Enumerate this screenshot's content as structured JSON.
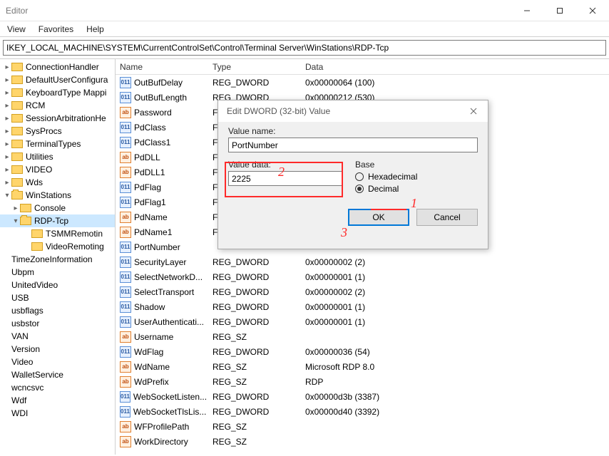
{
  "window": {
    "title": "Editor"
  },
  "menu": {
    "items": [
      "View",
      "Favorites",
      "Help"
    ]
  },
  "address": "IKEY_LOCAL_MACHINE\\SYSTEM\\CurrentControlSet\\Control\\Terminal Server\\WinStations\\RDP-Tcp",
  "tree": [
    {
      "level": 1,
      "expand": ">",
      "label": "ConnectionHandler",
      "folder": true
    },
    {
      "level": 1,
      "expand": ">",
      "label": "DefaultUserConfigura",
      "folder": true
    },
    {
      "level": 1,
      "expand": ">",
      "label": "KeyboardType Mappi",
      "folder": true
    },
    {
      "level": 1,
      "expand": ">",
      "label": "RCM",
      "folder": true
    },
    {
      "level": 1,
      "expand": ">",
      "label": "SessionArbitrationHe",
      "folder": true
    },
    {
      "level": 1,
      "expand": ">",
      "label": "SysProcs",
      "folder": true
    },
    {
      "level": 1,
      "expand": ">",
      "label": "TerminalTypes",
      "folder": true
    },
    {
      "level": 1,
      "expand": ">",
      "label": "Utilities",
      "folder": true
    },
    {
      "level": 1,
      "expand": ">",
      "label": "VIDEO",
      "folder": true
    },
    {
      "level": 1,
      "expand": ">",
      "label": "Wds",
      "folder": true
    },
    {
      "level": 1,
      "expand": "v",
      "label": "WinStations",
      "folder": true
    },
    {
      "level": 2,
      "expand": ">",
      "label": "Console",
      "folder": true
    },
    {
      "level": 2,
      "expand": "v",
      "label": "RDP-Tcp",
      "folder": true,
      "selected": true
    },
    {
      "level": 3,
      "expand": "",
      "label": "TSMMRemotin",
      "folder": true
    },
    {
      "level": 3,
      "expand": "",
      "label": "VideoRemoting",
      "folder": true
    },
    {
      "level": 0,
      "expand": "",
      "label": "TimeZoneInformation",
      "folder": false
    },
    {
      "level": 0,
      "expand": "",
      "label": "Ubpm",
      "folder": false
    },
    {
      "level": 0,
      "expand": "",
      "label": "UnitedVideo",
      "folder": false
    },
    {
      "level": 0,
      "expand": "",
      "label": "USB",
      "folder": false
    },
    {
      "level": 0,
      "expand": "",
      "label": "usbflags",
      "folder": false
    },
    {
      "level": 0,
      "expand": "",
      "label": "usbstor",
      "folder": false
    },
    {
      "level": 0,
      "expand": "",
      "label": "VAN",
      "folder": false
    },
    {
      "level": 0,
      "expand": "",
      "label": "Version",
      "folder": false
    },
    {
      "level": 0,
      "expand": "",
      "label": "Video",
      "folder": false
    },
    {
      "level": 0,
      "expand": "",
      "label": "WalletService",
      "folder": false
    },
    {
      "level": 0,
      "expand": "",
      "label": "wcncsvc",
      "folder": false
    },
    {
      "level": 0,
      "expand": "",
      "label": "Wdf",
      "folder": false
    },
    {
      "level": 0,
      "expand": "",
      "label": "WDI",
      "folder": false
    }
  ],
  "list": {
    "headers": {
      "name": "Name",
      "type": "Type",
      "data": "Data"
    },
    "rows": [
      {
        "icon": "dword",
        "name": "OutBufDelay",
        "type": "REG_DWORD",
        "data": "0x00000064 (100)"
      },
      {
        "icon": "dword",
        "name": "OutBufLength",
        "type": "REG_DWORD",
        "data": "0x00000212 (530)"
      },
      {
        "icon": "sz",
        "name": "Password",
        "type": "F",
        "data": ""
      },
      {
        "icon": "dword",
        "name": "PdClass",
        "type": "F",
        "data": ""
      },
      {
        "icon": "dword",
        "name": "PdClass1",
        "type": "F",
        "data": ""
      },
      {
        "icon": "sz",
        "name": "PdDLL",
        "type": "F",
        "data": ""
      },
      {
        "icon": "sz",
        "name": "PdDLL1",
        "type": "F",
        "data": ""
      },
      {
        "icon": "dword",
        "name": "PdFlag",
        "type": "F",
        "data": ""
      },
      {
        "icon": "dword",
        "name": "PdFlag1",
        "type": "F",
        "data": ""
      },
      {
        "icon": "sz",
        "name": "PdName",
        "type": "F",
        "data": ""
      },
      {
        "icon": "sz",
        "name": "PdName1",
        "type": "F",
        "data": ""
      },
      {
        "icon": "dword",
        "name": "PortNumber",
        "type": "",
        "data": ""
      },
      {
        "icon": "dword",
        "name": "SecurityLayer",
        "type": "REG_DWORD",
        "data": "0x00000002 (2)"
      },
      {
        "icon": "dword",
        "name": "SelectNetworkD...",
        "type": "REG_DWORD",
        "data": "0x00000001 (1)"
      },
      {
        "icon": "dword",
        "name": "SelectTransport",
        "type": "REG_DWORD",
        "data": "0x00000002 (2)"
      },
      {
        "icon": "dword",
        "name": "Shadow",
        "type": "REG_DWORD",
        "data": "0x00000001 (1)"
      },
      {
        "icon": "dword",
        "name": "UserAuthenticati...",
        "type": "REG_DWORD",
        "data": "0x00000001 (1)"
      },
      {
        "icon": "sz",
        "name": "Username",
        "type": "REG_SZ",
        "data": ""
      },
      {
        "icon": "dword",
        "name": "WdFlag",
        "type": "REG_DWORD",
        "data": "0x00000036 (54)"
      },
      {
        "icon": "sz",
        "name": "WdName",
        "type": "REG_SZ",
        "data": "Microsoft RDP 8.0"
      },
      {
        "icon": "sz",
        "name": "WdPrefix",
        "type": "REG_SZ",
        "data": "RDP"
      },
      {
        "icon": "dword",
        "name": "WebSocketListen...",
        "type": "REG_DWORD",
        "data": "0x00000d3b (3387)"
      },
      {
        "icon": "dword",
        "name": "WebSocketTlsLis...",
        "type": "REG_DWORD",
        "data": "0x00000d40 (3392)"
      },
      {
        "icon": "sz",
        "name": "WFProfilePath",
        "type": "REG_SZ",
        "data": ""
      },
      {
        "icon": "sz",
        "name": "WorkDirectory",
        "type": "REG_SZ",
        "data": ""
      }
    ]
  },
  "dialog": {
    "title": "Edit DWORD (32-bit) Value",
    "value_name_label": "Value name:",
    "value_name": "PortNumber",
    "value_data_label": "Value data:",
    "value_data": "2225",
    "base_label": "Base",
    "hex_label": "Hexadecimal",
    "dec_label": "Decimal",
    "base_selected": "decimal",
    "ok": "OK",
    "cancel": "Cancel"
  },
  "annotations": {
    "n1": "1",
    "n2": "2",
    "n3": "3"
  }
}
